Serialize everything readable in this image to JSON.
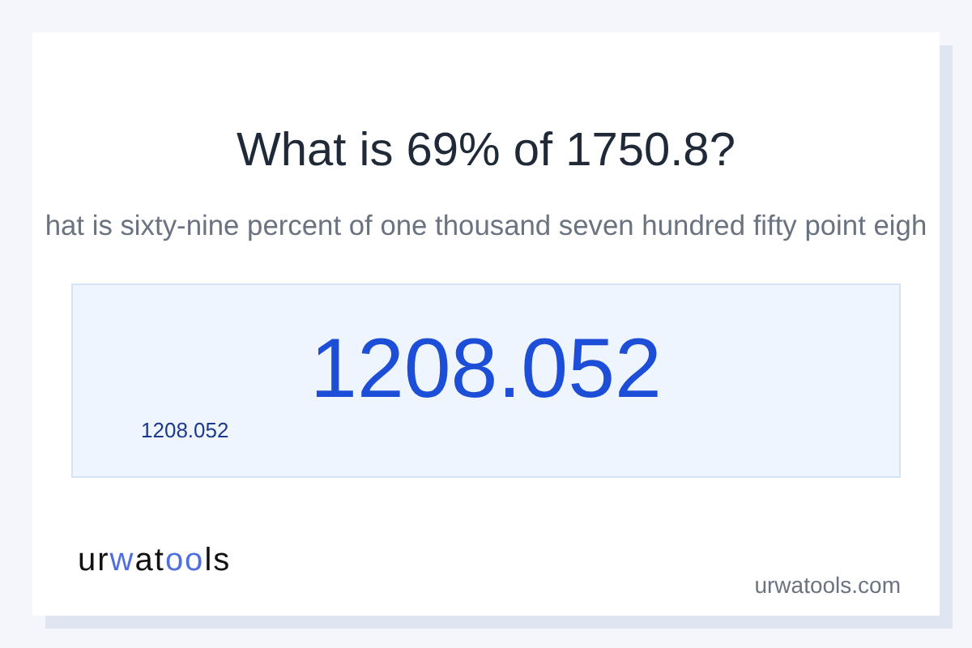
{
  "title": "What is 69% of 1750.8?",
  "subtitle": "hat is sixty-nine percent of one thousand seven hundred fifty point eigh",
  "result": {
    "value": "1208.052",
    "caption": "1208.052"
  },
  "logo": [
    {
      "text": "ur",
      "accent": false
    },
    {
      "text": "w",
      "accent": true
    },
    {
      "text": "at",
      "accent": false
    },
    {
      "text": "oo",
      "accent": true
    },
    {
      "text": "ls",
      "accent": false
    }
  ],
  "site": "urwatools.com"
}
